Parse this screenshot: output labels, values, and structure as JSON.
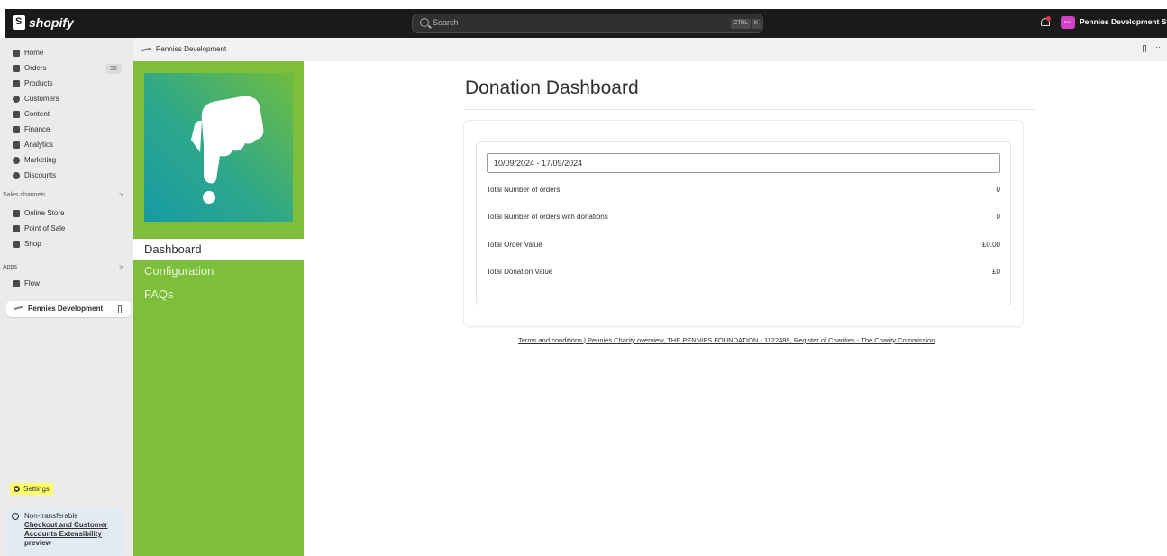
{
  "topbar": {
    "brand": "shopify",
    "search_placeholder": "Search",
    "shortcut_keys": [
      "CTRL",
      "K"
    ],
    "store_badge": "PDS",
    "store_name": "Pennies Development Stor"
  },
  "leftnav": {
    "items": [
      {
        "label": "Home",
        "icon": "home-icon"
      },
      {
        "label": "Orders",
        "icon": "orders-icon",
        "badge": "35"
      },
      {
        "label": "Products",
        "icon": "tag-icon"
      },
      {
        "label": "Customers",
        "icon": "person-icon"
      },
      {
        "label": "Content",
        "icon": "content-icon"
      },
      {
        "label": "Finance",
        "icon": "bank-icon"
      },
      {
        "label": "Analytics",
        "icon": "bar-chart-icon"
      },
      {
        "label": "Marketing",
        "icon": "target-icon"
      },
      {
        "label": "Discounts",
        "icon": "discount-icon"
      }
    ],
    "sales_channels_label": "Sales channels",
    "sales_channels": [
      {
        "label": "Online Store",
        "icon": "store-icon"
      },
      {
        "label": "Point of Sale",
        "icon": "pos-icon"
      },
      {
        "label": "Shop",
        "icon": "shop-icon"
      }
    ],
    "apps_label": "Apps",
    "apps": [
      {
        "label": "Flow",
        "icon": "flow-icon"
      }
    ],
    "pinned_app": "Pennies Development",
    "settings_label": "Settings",
    "notice": {
      "title": "Non-transferable",
      "link": "Checkout and Customer Accounts Extensibility",
      "suffix": "preview"
    }
  },
  "app_header": {
    "title": "Pennies Development"
  },
  "app_nav": {
    "items": [
      "Dashboard",
      "Configuration",
      "FAQs"
    ],
    "active": "Dashboard"
  },
  "dashboard": {
    "title": "Donation Dashboard",
    "date_range": "10/09/2024 - 17/09/2024",
    "metrics": [
      {
        "label": "Total Number of orders",
        "value": "0"
      },
      {
        "label": "Total Number of orders with donations",
        "value": "0"
      },
      {
        "label": "Total Order Value",
        "value": "£0.00"
      },
      {
        "label": "Total Donation Value",
        "value": "£0"
      }
    ],
    "footer_text": "Terms and conditions | Pennies Charity overview, THE PENNIES FOUNDATION - 1122489, Register of Charities - The Charity Commission"
  },
  "colors": {
    "topbar_bg": "#1a1a1a",
    "sidebar_bg": "#ebebeb",
    "app_green": "#7dbf3a",
    "settings_highlight": "#ffff66",
    "store_badge": "#d440c6"
  }
}
